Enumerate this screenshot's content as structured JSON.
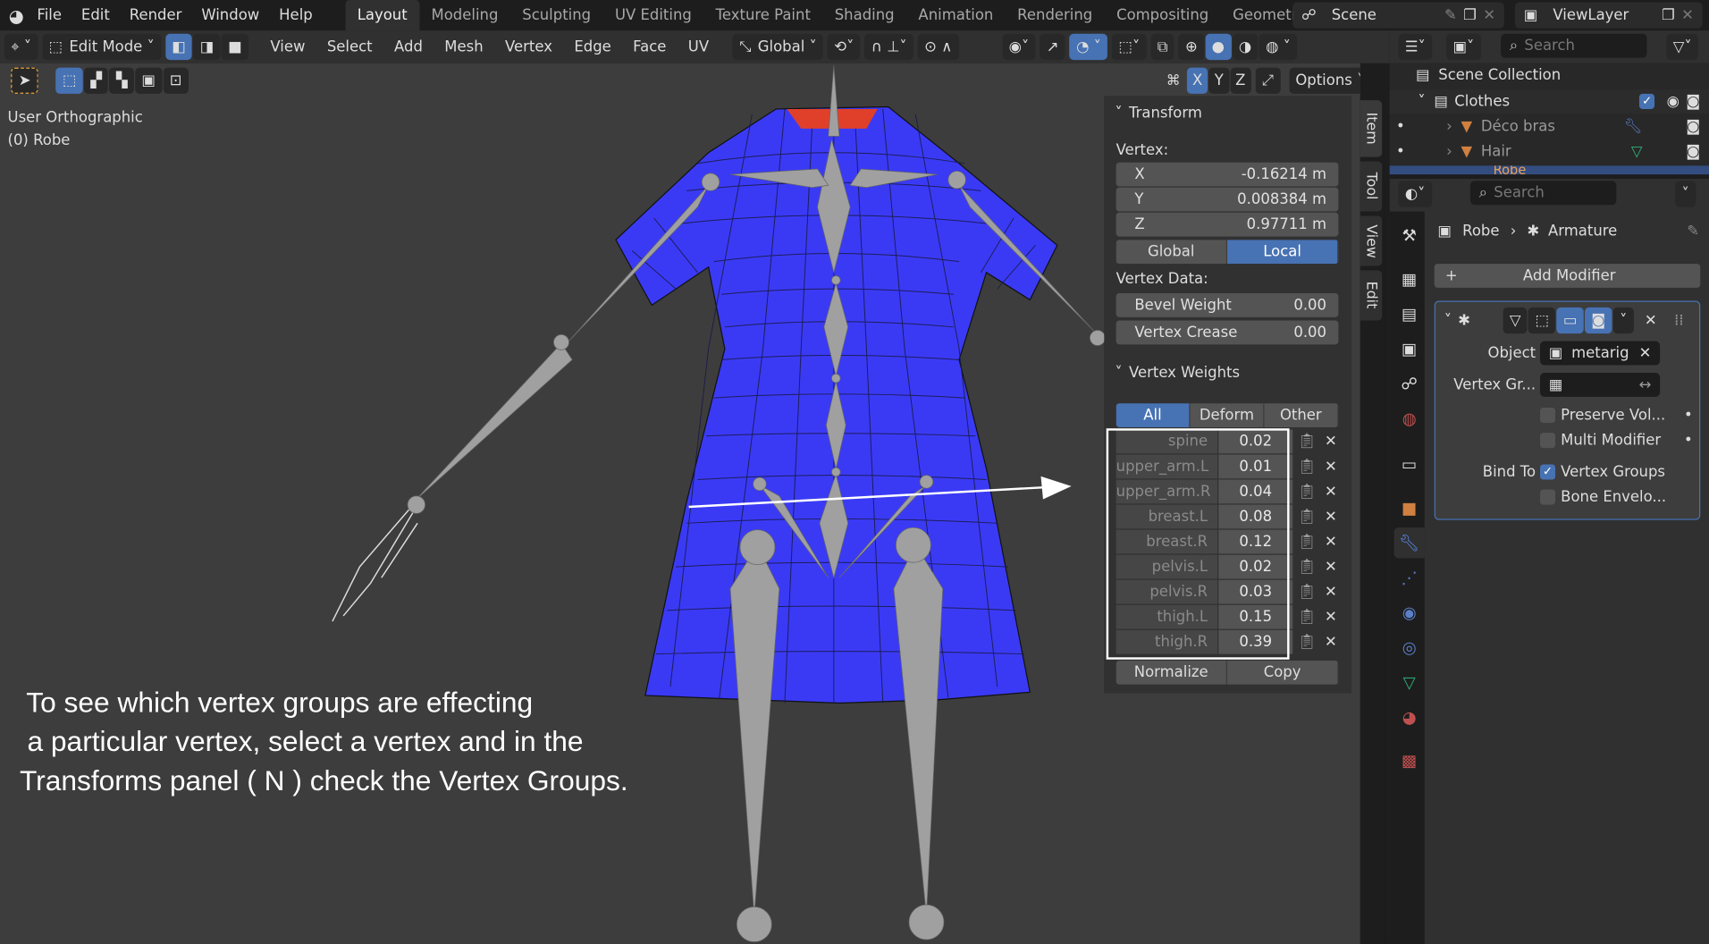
{
  "topbar": {
    "menus": [
      "File",
      "Edit",
      "Render",
      "Window",
      "Help"
    ],
    "workspaces": [
      "Layout",
      "Modeling",
      "Sculpting",
      "UV Editing",
      "Texture Paint",
      "Shading",
      "Animation",
      "Rendering",
      "Compositing",
      "Geometry Nodes"
    ],
    "active_workspace": "Layout",
    "scene": "Scene",
    "view_layer": "ViewLayer"
  },
  "toolbar": {
    "mode": "Edit Mode",
    "menus": [
      "View",
      "Select",
      "Add",
      "Mesh",
      "Vertex",
      "Edge",
      "Face",
      "UV"
    ],
    "orientation": "Global",
    "axes": [
      "X",
      "Y",
      "Z"
    ],
    "options": "Options"
  },
  "viewport": {
    "view_name": "User Orthographic",
    "object_name": "(0) Robe",
    "mesh_color": "#3a3aff",
    "bone_color": "#a0a0a0"
  },
  "npanel": {
    "tabs": [
      "Item",
      "Tool",
      "View",
      "Edit"
    ],
    "transform": {
      "title": "Transform",
      "vertex_label": "Vertex:",
      "x_label": "X",
      "x": "-0.16214 m",
      "y_label": "Y",
      "y": "0.008384 m",
      "z_label": "Z",
      "z": "0.97711 m",
      "global": "Global",
      "local": "Local",
      "space_active": "Local",
      "vertex_data_label": "Vertex Data:",
      "bevel_label": "Bevel Weight",
      "bevel": "0.00",
      "crease_label": "Vertex Crease",
      "crease": "0.00"
    },
    "weights": {
      "title": "Vertex Weights",
      "filters": [
        "All",
        "Deform",
        "Other"
      ],
      "active_filter": "All",
      "groups": [
        {
          "name": "spine",
          "value": "0.02"
        },
        {
          "name": "upper_arm.L",
          "value": "0.01"
        },
        {
          "name": "upper_arm.R",
          "value": "0.04"
        },
        {
          "name": "breast.L",
          "value": "0.08"
        },
        {
          "name": "breast.R",
          "value": "0.12"
        },
        {
          "name": "pelvis.L",
          "value": "0.02"
        },
        {
          "name": "pelvis.R",
          "value": "0.03"
        },
        {
          "name": "thigh.L",
          "value": "0.15"
        },
        {
          "name": "thigh.R",
          "value": "0.39"
        }
      ],
      "normalize": "Normalize",
      "copy": "Copy"
    }
  },
  "outliner": {
    "search_placeholder": "Search",
    "scene_collection": "Scene Collection",
    "collection": "Clothes",
    "items": [
      "Déco bras",
      "Hair",
      "Robe"
    ]
  },
  "properties": {
    "search_placeholder": "Search",
    "object": "Robe",
    "modifier": "Armature",
    "add_modifier": "Add Modifier",
    "object_label": "Object",
    "object_value": "metarig",
    "vgroup_label": "Vertex Gr...",
    "preserve_volume": "Preserve Vol...",
    "multi_modifier": "Multi Modifier",
    "bind_to_label": "Bind To",
    "vertex_groups": "Vertex Groups",
    "vertex_groups_checked": true,
    "bone_envelopes": "Bone Envelo...",
    "bone_envelopes_checked": false
  },
  "annotation": {
    "lines": [
      "To see which vertex groups are effecting",
      "a particular vertex, select a vertex and in the",
      "Transforms panel ( N ) check the Vertex Groups."
    ]
  },
  "colors": {
    "accent": "#4772b3",
    "highlight_box": "#ffffff"
  }
}
